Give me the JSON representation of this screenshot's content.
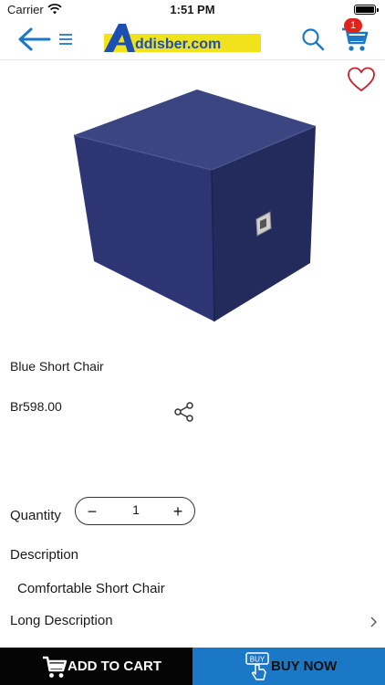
{
  "status_bar": {
    "carrier": "Carrier",
    "time": "1:51 PM"
  },
  "header": {
    "logo_text": "Addisber.com",
    "cart_count": "1",
    "icons": [
      "back-arrow-icon",
      "hamburger-menu-icon",
      "search-icon",
      "shopping-cart-icon"
    ],
    "accent_color": "#1b78c6"
  },
  "product": {
    "name": "Blue Short Chair",
    "price": "Br598.00",
    "wishlist_icon": "heart-outline-icon",
    "share_icon": "share-icon"
  },
  "quantity": {
    "label": "Quantity",
    "minus": "−",
    "value": "1",
    "plus": "+"
  },
  "description": {
    "heading": "Description",
    "text": "Comfortable Short Chair"
  },
  "long_description": {
    "label": "Long Description"
  },
  "actions": {
    "add_to_cart": "ADD TO CART",
    "buy_now": "BUY NOW",
    "buy_icon_text": "BUY",
    "add_to_cart_bg": "#050505",
    "buy_now_bg": "#1b78c6"
  }
}
